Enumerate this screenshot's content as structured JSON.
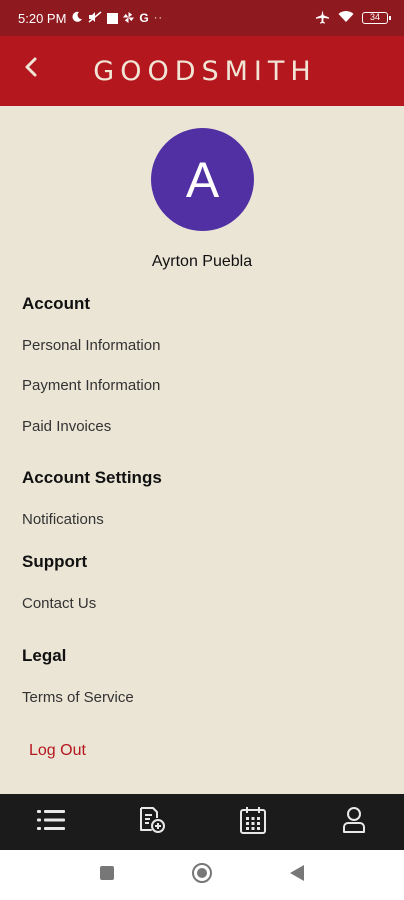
{
  "status_bar": {
    "time": "5:20 PM",
    "battery": "34"
  },
  "app_bar": {
    "title": "GOODSMITH"
  },
  "profile": {
    "avatar_initial": "A",
    "name": "Ayrton Puebla"
  },
  "sections": [
    {
      "title": "Account",
      "items": [
        "Personal Information",
        "Payment Information",
        "Paid Invoices"
      ]
    },
    {
      "title": "Account Settings",
      "items": [
        "Notifications"
      ]
    },
    {
      "title": "Support",
      "items": [
        "Contact Us"
      ]
    },
    {
      "title": "Legal",
      "items": [
        "Terms of Service"
      ]
    }
  ],
  "logout_label": "Log Out",
  "colors": {
    "status_bar": "#8e1a1f",
    "app_bar": "#b5171f",
    "background": "#ebe5d6",
    "avatar": "#5130a3",
    "accent": "#b5171f",
    "bottom_nav": "#1b1b1b"
  },
  "bottom_nav_icons": [
    "list-icon",
    "add-document-icon",
    "calendar-icon",
    "profile-icon"
  ]
}
